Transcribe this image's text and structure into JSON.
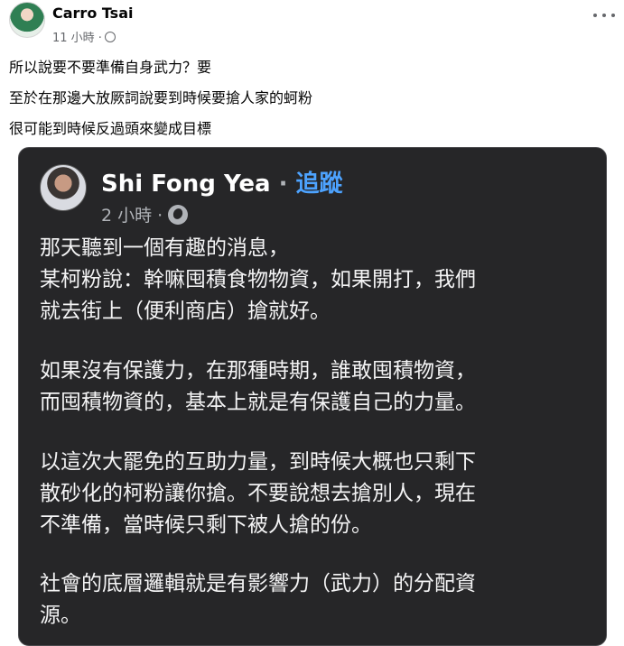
{
  "post": {
    "author": "Carro Tsai",
    "time": "11 小時 ·",
    "lines": [
      "所以說要不要準備自身武力？要",
      "至於在那邊大放厥詞說要到時候要搶人家的蚵粉",
      "很可能到時候反過頭來變成目標"
    ]
  },
  "shared": {
    "author": "Shi Fong Yea",
    "separator": " · ",
    "follow": "追蹤",
    "time": "2 小時 ·",
    "paragraphs": [
      "那天聽到一個有趣的消息，\n某柯粉說：幹嘛囤積食物物資，如果開打，我們\n就去街上（便利商店）搶就好。",
      "如果沒有保護力，在那種時期，誰敢囤積物資，\n而囤積物資的，基本上就是有保護自己的力量。",
      "以這次大罷免的互助力量，到時候大概也只剩下\n散砂化的柯粉讓你搶。不要說想去搶別人，現在\n不準備，當時候只剩下被人搶的份。",
      "社會的底層邏輯就是有影響力（武力）的分配資\n源。"
    ]
  }
}
